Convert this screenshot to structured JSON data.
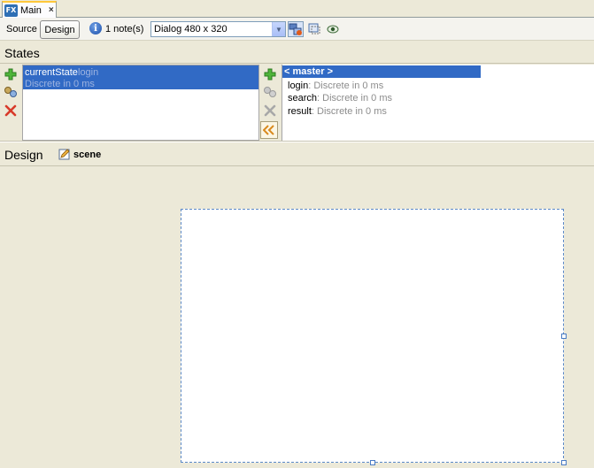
{
  "tabs": [
    {
      "label": "Main",
      "icon": "fx-file-icon",
      "active": true
    }
  ],
  "toolbar": {
    "source_label": "Source",
    "design_label": "Design",
    "notes_label": "1 note(s)",
    "device_select": {
      "selected": "Dialog 480 x 320"
    }
  },
  "states": {
    "title": "States",
    "left": {
      "name": "currentState",
      "value": "login",
      "sub": "Discrete in 0 ms"
    },
    "right": {
      "master": "< master >",
      "items": [
        {
          "name": "login",
          "detail": ": Discrete in 0 ms"
        },
        {
          "name": "search",
          "detail": ": Discrete in 0 ms"
        },
        {
          "name": "result",
          "detail": ": Discrete in 0 ms"
        }
      ]
    }
  },
  "design": {
    "title": "Design",
    "scene_label": "scene"
  },
  "colors": {
    "background": "#ece9d8",
    "selection": "#316ac5",
    "tab_accent": "#ffc83c"
  }
}
